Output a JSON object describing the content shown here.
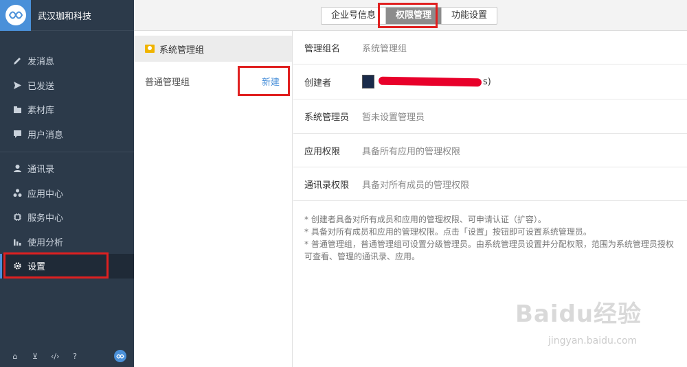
{
  "brand": {
    "name": "武汉珈和科技"
  },
  "sidebar": {
    "group1": [
      {
        "label": "发消息",
        "icon": "pencil-icon"
      },
      {
        "label": "已发送",
        "icon": "send-icon"
      },
      {
        "label": "素材库",
        "icon": "folder-icon"
      },
      {
        "label": "用户消息",
        "icon": "chat-icon"
      }
    ],
    "group2": [
      {
        "label": "通讯录",
        "icon": "contacts-icon"
      },
      {
        "label": "应用中心",
        "icon": "apps-icon"
      },
      {
        "label": "服务中心",
        "icon": "service-icon"
      },
      {
        "label": "使用分析",
        "icon": "chart-icon"
      },
      {
        "label": "设置",
        "icon": "gear-icon",
        "active": true
      }
    ],
    "footer_icons": [
      "home-icon",
      "cart-icon",
      "code-icon",
      "help-icon",
      "brand-logo-icon"
    ]
  },
  "tabs": [
    {
      "label": "企业号信息"
    },
    {
      "label": "权限管理",
      "active": true
    },
    {
      "label": "功能设置"
    }
  ],
  "groups": {
    "selected_label": "系统管理组",
    "other_label": "普通管理组",
    "new_label": "新建"
  },
  "detail": {
    "rows": [
      {
        "label": "管理组名",
        "value": "系统管理组"
      },
      {
        "label": "创建者",
        "value": ""
      },
      {
        "label": "系统管理员",
        "value": "暂未设置管理员"
      },
      {
        "label": "应用权限",
        "value": "具备所有应用的管理权限"
      },
      {
        "label": "通讯录权限",
        "value": "具备对所有成员的管理权限"
      }
    ],
    "creator_tail": "s)",
    "notes": [
      "* 创建者具备对所有成员和应用的管理权限、可申请认证（扩容）。",
      "* 具备对所有成员和应用的管理权限。点击「设置」按钮即可设置系统管理员。",
      "* 普通管理组，普通管理组可设置分级管理员。由系统管理员设置并分配权限，范围为系统管理员授权可查看、管理的通讯录、应用。"
    ]
  },
  "watermark": {
    "main": "Baidu经验",
    "sub": "jingyan.baidu.com"
  },
  "colors": {
    "sidebar_bg": "#2c3a4a",
    "accent": "#4a90d9",
    "highlight": "#e02020",
    "tab_active": "#8c8c8c"
  }
}
